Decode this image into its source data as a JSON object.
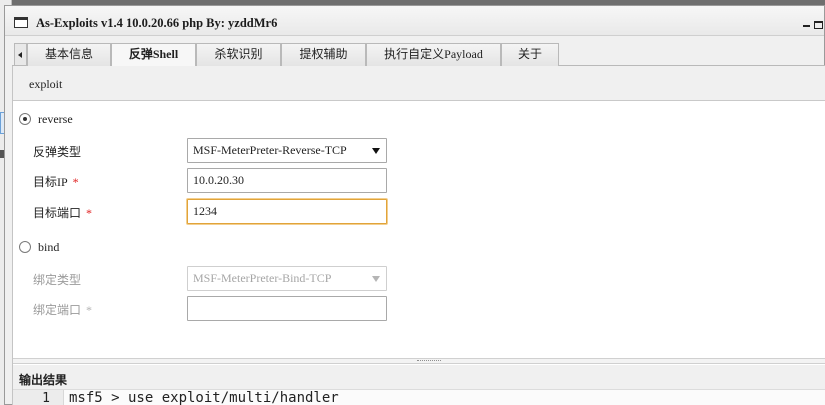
{
  "window": {
    "title": "As-Exploits v1.4 10.0.20.66 php By: yzddMr6"
  },
  "tabs": [
    {
      "label": "基本信息"
    },
    {
      "label": "反弹Shell"
    },
    {
      "label": "杀软识别"
    },
    {
      "label": "提权辅助"
    },
    {
      "label": "执行自定义Payload"
    },
    {
      "label": "关于"
    }
  ],
  "subtab": {
    "label": "exploit"
  },
  "reverse": {
    "radio_label": "reverse",
    "type_label": "反弹类型",
    "type_value": "MSF-MeterPreter-Reverse-TCP",
    "ip_label": "目标IP",
    "ip_value": "10.0.20.30",
    "port_label": "目标端口",
    "port_value": "1234",
    "required_mark": "*"
  },
  "bind": {
    "radio_label": "bind",
    "type_label": "绑定类型",
    "type_value": "MSF-MeterPreter-Bind-TCP",
    "port_label": "绑定端口",
    "port_value": "",
    "required_mark": "*"
  },
  "output": {
    "title": "输出结果",
    "lines": [
      {
        "number": "1",
        "text": "msf5 > use exploit/multi/handler"
      }
    ]
  }
}
